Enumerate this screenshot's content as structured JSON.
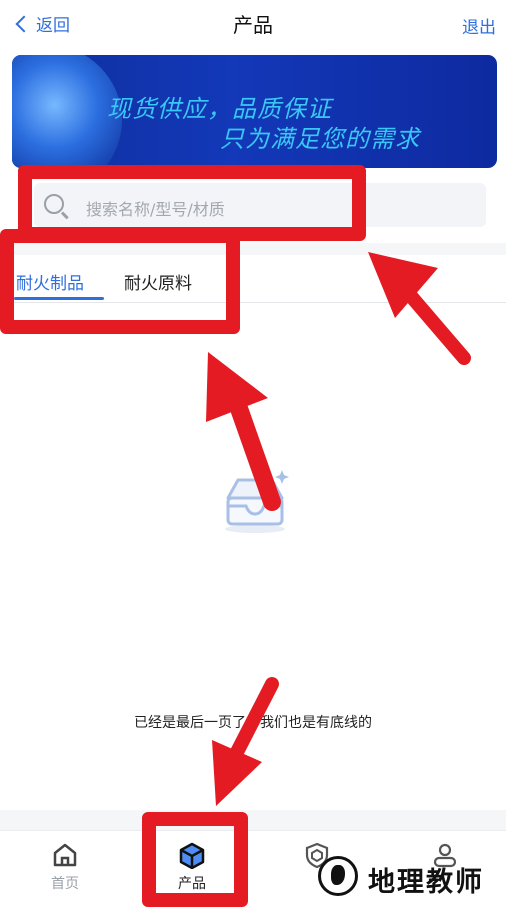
{
  "header": {
    "back_label": "返回",
    "title": "产品",
    "logout_label": "退出"
  },
  "banner": {
    "line1": "现货供应，品质保证",
    "line2": "只为满足您的需求"
  },
  "search": {
    "placeholder": "搜索名称/型号/材质"
  },
  "tabs": [
    {
      "label": "耐火制品",
      "active": true
    },
    {
      "label": "耐火原料",
      "active": false
    }
  ],
  "list": {
    "end_text": "已经是最后一页了，我们也是有底线的"
  },
  "bottom_nav": [
    {
      "label": "首页",
      "icon": "home-icon",
      "active": false
    },
    {
      "label": "产品",
      "icon": "cube-icon",
      "active": true
    },
    {
      "label": "",
      "icon": "shield-icon",
      "active": false
    },
    {
      "label": "",
      "icon": "user-icon",
      "active": false
    }
  ],
  "watermark": {
    "text": "地理教师"
  },
  "colors": {
    "accent": "#2f6fdd",
    "annotation": "#e41b23",
    "banner": "#1338b8"
  }
}
